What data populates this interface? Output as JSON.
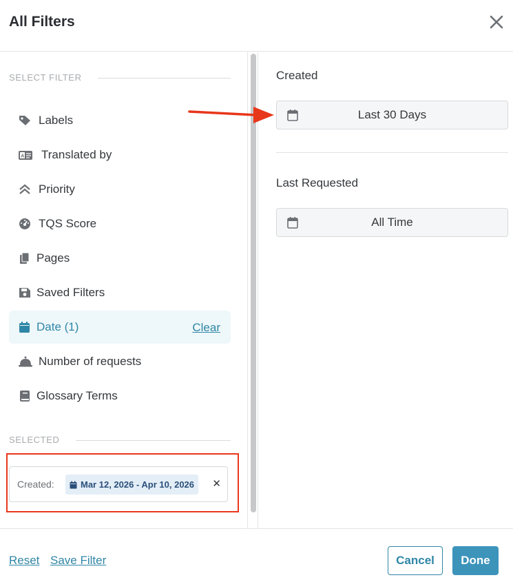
{
  "header": {
    "title": "All Filters",
    "close_icon": "close-icon"
  },
  "sidebar": {
    "section_label": "SELECT FILTER",
    "items": [
      {
        "label": "Labels",
        "icon": "tag-icon"
      },
      {
        "label": "Translated by",
        "icon": "translate-icon"
      },
      {
        "label": "Priority",
        "icon": "chevron-up-double-icon"
      },
      {
        "label": "TQS Score",
        "icon": "gauge-icon"
      },
      {
        "label": "Pages",
        "icon": "pages-icon"
      },
      {
        "label": "Saved Filters",
        "icon": "floppy-disk-icon"
      },
      {
        "label": "Date (1)",
        "icon": "calendar-icon",
        "active": true,
        "action": "Clear"
      },
      {
        "label": "Number of requests",
        "icon": "bell-icon"
      },
      {
        "label": "Glossary Terms",
        "icon": "book-icon"
      }
    ],
    "selected_label": "SELECTED",
    "selected_chip": {
      "label": "Created:",
      "value": "Mar 12, 2026 - Apr 10, 2026",
      "icon": "calendar-icon"
    }
  },
  "main": {
    "created": {
      "heading": "Created",
      "value": "Last 30 Days"
    },
    "last_requested": {
      "heading": "Last Requested",
      "value": "All Time"
    }
  },
  "footer": {
    "reset": "Reset",
    "save_filter": "Save Filter",
    "cancel": "Cancel",
    "done": "Done"
  },
  "colors": {
    "accent": "#2f86a6",
    "primary_button": "#3d94bb",
    "annotation_red": "#e8361b",
    "active_row_bg": "#eef7fa"
  }
}
